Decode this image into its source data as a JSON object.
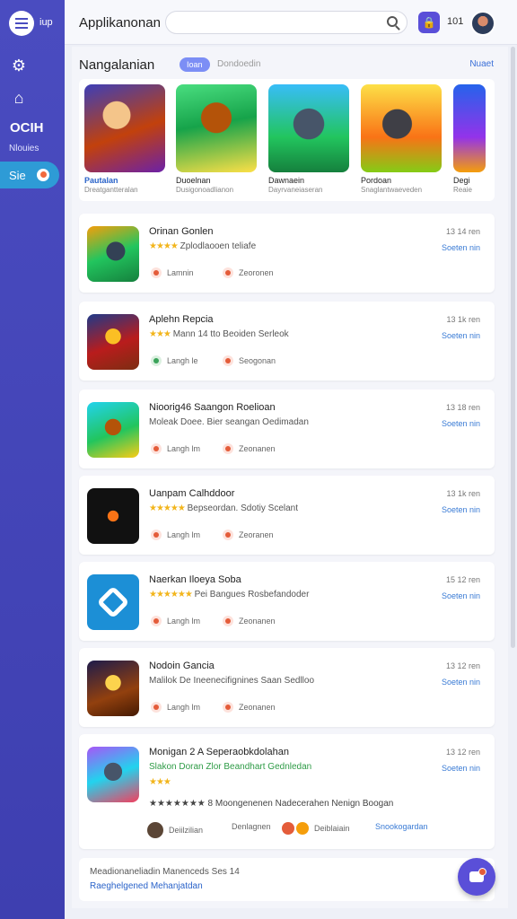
{
  "sidebar": {
    "brand": "iup",
    "text_item": "OCIH",
    "small_item": "Nlouies",
    "active_label": "Sie",
    "icons": [
      "menu-icon",
      "gear-icon",
      "home-icon"
    ]
  },
  "header": {
    "title": "Applikanonan",
    "search_placeholder": "",
    "notif_count": "101"
  },
  "section": {
    "title": "Nangalanian",
    "pill": "Ioan",
    "sub": "Dondoedin",
    "link": "Nuaet"
  },
  "featured": [
    {
      "name": "Pautalan",
      "sub": "Dreatgantteralan"
    },
    {
      "name": "Duoelnan",
      "sub": "Dusigonoadlianon"
    },
    {
      "name": "Dawnaein",
      "sub": "Dayrvaneiaseran"
    },
    {
      "name": "Pordoan",
      "sub": "Snaglantwaeveden"
    },
    {
      "name": "Degi",
      "sub": "Reaie"
    }
  ],
  "cards": [
    {
      "title": "Orinan Gonlen",
      "stars": "★★★★",
      "desc": "Zplodlaooen teliafe",
      "meta1": "13 14  ren",
      "meta2": "Soeten  nin",
      "tag1": "Lamnin",
      "tag2": "Zeoronen"
    },
    {
      "title": "Aplehn Repcia",
      "stars": "★★★",
      "desc": "Mann  14 tto Beoiden Serleok",
      "meta1": "13 1k  ren",
      "meta2": "Soeten  nin",
      "tag1": "Langh le",
      "tag2": "Seogonan"
    },
    {
      "title": "Nioorig46 Saangon Roelioan",
      "stars": "",
      "desc": "Moleak Doee. Bier seangan Oedimadan",
      "meta1": "13 18  ren",
      "meta2": "Soeten  nin",
      "tag1": "Langh lm",
      "tag2": "Zeonanen"
    },
    {
      "title": "Uanpam Calhddoor",
      "stars": "★★★★★",
      "desc": "Bepseordan. Sdotiy Scelant",
      "meta1": "13 1k  ren",
      "meta2": "Soeten  nin",
      "tag1": "Langh lm",
      "tag2": "Zeoranen"
    },
    {
      "title": "Naerkan Iloeya Soba",
      "stars": "★★★★★★",
      "desc": "Pei Bangues Rosbefandoder",
      "meta1": "15 12  ren",
      "meta2": "Soeten  nin",
      "tag1": "Langh lm",
      "tag2": "Zeonanen"
    },
    {
      "title": "Nodoin Gancia",
      "stars": "",
      "desc": "Malilok De Ineenecifignines Saan Sedlloo",
      "meta1": "13 12  ren",
      "meta2": "Soeten  nin",
      "tag1": "Langh lm",
      "tag2": "Zeonanen"
    }
  ],
  "last_card": {
    "title": "Monigan 2 A Seperaobkdolahan",
    "desc": "Slakon Doran  Zlor Beandhart Gednledan",
    "stars": "★★★",
    "rating_line": "★★★★★★★ 8 Moongenenen Nadecerahen Nenign Boogan",
    "meta1": "13 12  ren",
    "meta2": "Soeten  nin",
    "user": "Deiilzilian",
    "tag2": "Denlagnen",
    "tag3": "Deiblaiain",
    "link": "Snookogardan"
  },
  "footer": {
    "text": "Meadionaneliadin Manenceds Ses 14",
    "link": "Raeghelgened Mehanjatdan"
  },
  "colors": {
    "sidebar": "#4a4cc0",
    "active": "#2e9bd6",
    "accent": "#5a4fd8",
    "link": "#3a7bd5",
    "star": "#f2b51c"
  }
}
